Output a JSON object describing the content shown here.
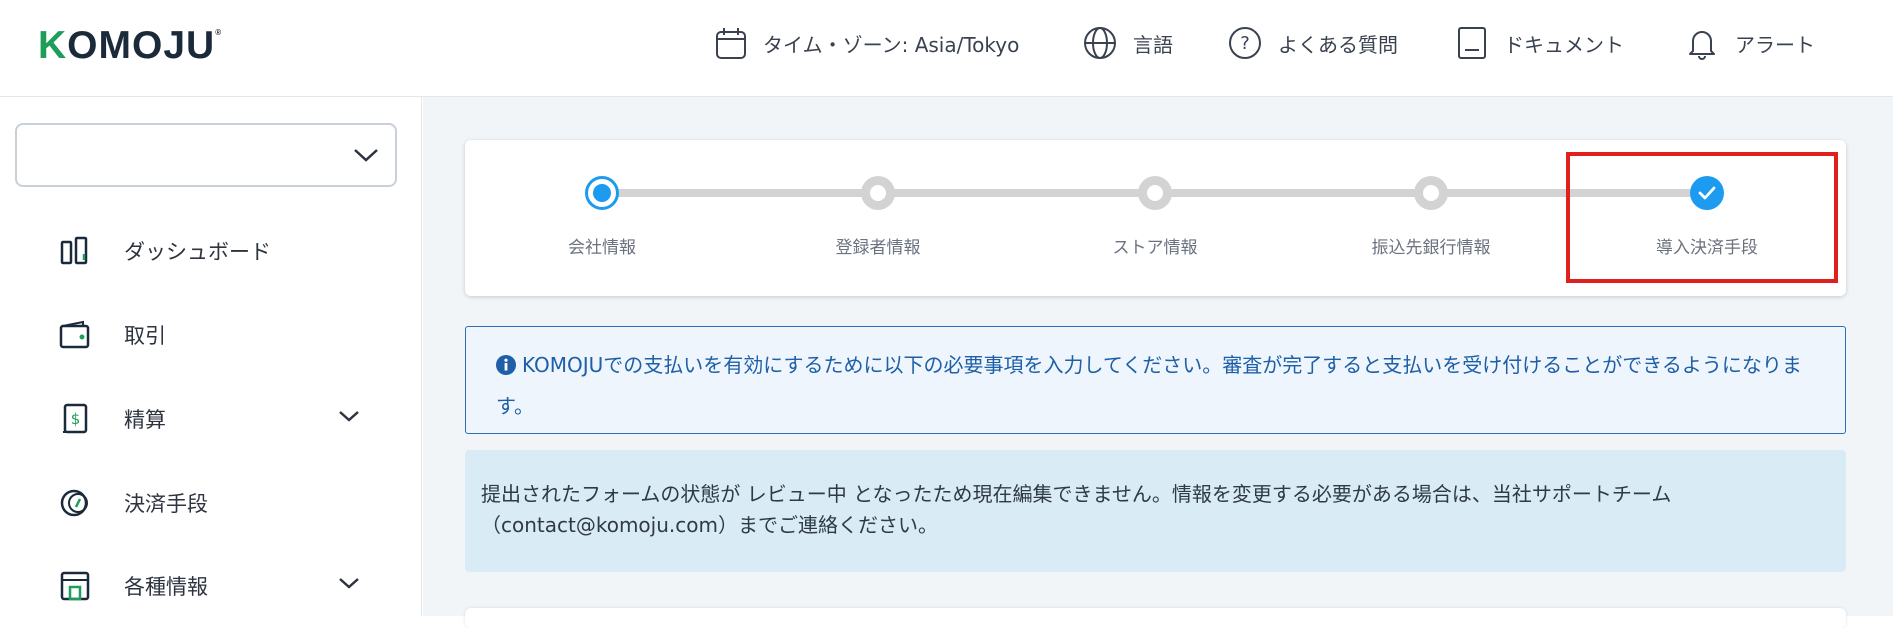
{
  "header": {
    "logo_text": "KOMOJU",
    "logo_mark": "®",
    "nav": [
      {
        "icon": "calendar-icon",
        "label": "タイム・ゾーン: Asia/Tokyo"
      },
      {
        "icon": "globe-icon",
        "label": "言語"
      },
      {
        "icon": "question-icon",
        "label": "よくある質問"
      },
      {
        "icon": "document-icon",
        "label": "ドキュメント"
      },
      {
        "icon": "bell-icon",
        "label": "アラート"
      }
    ]
  },
  "sidebar": {
    "select_value": "",
    "items": [
      {
        "icon": "dashboard-icon",
        "label": "ダッシュボード",
        "expandable": false
      },
      {
        "icon": "wallet-icon",
        "label": "取引",
        "expandable": false
      },
      {
        "icon": "settlement-icon",
        "label": "精算",
        "expandable": true
      },
      {
        "icon": "payment-method-icon",
        "label": "決済手段",
        "expandable": false
      },
      {
        "icon": "store-icon",
        "label": "各種情報",
        "expandable": true
      }
    ]
  },
  "stepper": {
    "steps": [
      {
        "label": "会社情報",
        "state": "active"
      },
      {
        "label": "登録者情報",
        "state": "pending"
      },
      {
        "label": "ストア情報",
        "state": "pending"
      },
      {
        "label": "振込先銀行情報",
        "state": "pending"
      },
      {
        "label": "導入決済手段",
        "state": "complete"
      }
    ]
  },
  "info_message": "KOMOJUでの支払いを有効にするために以下の必要事項を入力してください。審査が完了すると支払いを受け付けることができるようになります。",
  "notice": {
    "line1": "提出されたフォームの状態が レビュー中 となったため現在編集できません。情報を変更する必要がある場合は、当社サポートチーム",
    "line2": "（contact@komoju.com）までご連絡ください。"
  },
  "colors": {
    "accent": "#1d9bf0",
    "brand_green": "#1f9d5a",
    "highlight": "#e0201c",
    "info_text": "#1e5fa8"
  }
}
